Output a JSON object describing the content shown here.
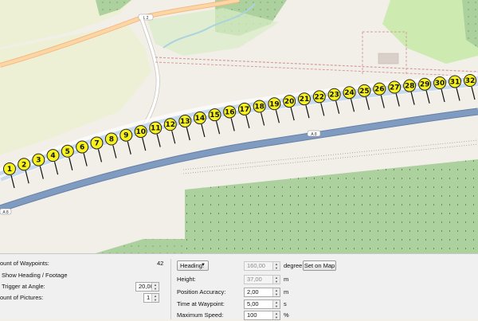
{
  "map": {
    "road_labels": {
      "upper": "A 8",
      "lower": "A 8",
      "top": "L 2"
    },
    "waypoints": [
      "1",
      "2",
      "3",
      "4",
      "5",
      "6",
      "7",
      "8",
      "9",
      "10",
      "11",
      "12",
      "13",
      "14",
      "15",
      "16",
      "17",
      "18",
      "19",
      "20",
      "21",
      "22",
      "23",
      "24",
      "25",
      "26",
      "27",
      "28",
      "29",
      "30",
      "31",
      "32"
    ],
    "colors": {
      "forest": "#add19e",
      "farmland": "#eef0d5",
      "motorway": "#809bc0",
      "marker": "#f7f21e"
    }
  },
  "panel": {
    "left": {
      "waypoint_count_label": "ount of Waypoints:",
      "waypoint_count_value": "42",
      "show_heading_label": "Show Heading / Footage",
      "trigger_label": "Trigger at Angle:",
      "trigger_value": "20,00",
      "pictures_label": "ount of Pictures:",
      "pictures_value": "1"
    },
    "right": {
      "heading_select": "Heading:",
      "heading_value": "160,00",
      "heading_unit": "degree",
      "set_on_map_label": "Set on Map",
      "height_label": "Height:",
      "height_value": "37,00",
      "height_unit": "m",
      "accuracy_label": "Position Accuracy:",
      "accuracy_value": "2,00",
      "accuracy_unit": "m",
      "time_label": "Time at Waypoint:",
      "time_value": "5,00",
      "time_unit": "s",
      "speed_label": "Maximum Speed:",
      "speed_value": "100",
      "speed_unit": "%"
    }
  }
}
